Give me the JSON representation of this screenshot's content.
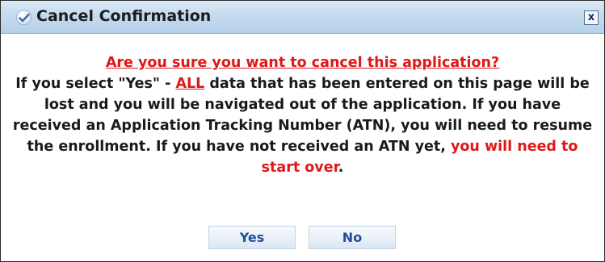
{
  "dialog": {
    "title": "Cancel Confirmation",
    "close_label": "x",
    "title_icon": "checkmark-icon"
  },
  "message": {
    "question": "Are you sure you want to cancel this application?",
    "line1_prefix": "If you select \"Yes\" - ",
    "all_emphasis": "ALL",
    "line1_suffix": " data that has been entered on this page will be lost and you will be navigated out of the application. If you have received an Application Tracking Number (ATN), you will need to resume the enrollment. If you have not received an ATN yet, ",
    "start_over": "you will need to start over",
    "end_punct": "."
  },
  "buttons": {
    "yes_label": "Yes",
    "no_label": "No"
  },
  "colors": {
    "warning": "#e01717",
    "button_text": "#1f4f9b",
    "titlebar": "#c5dbef"
  }
}
